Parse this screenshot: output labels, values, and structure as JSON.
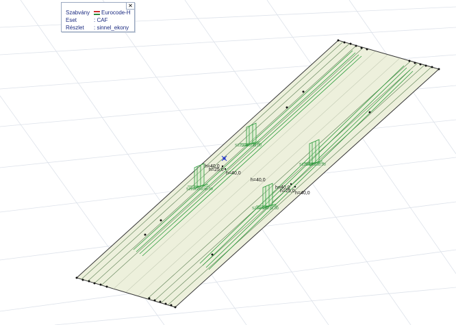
{
  "info_panel": {
    "close_label": "✕",
    "flag_colors": [
      "#cc2a2a",
      "#ffffff",
      "#2a8a3a"
    ],
    "rows": [
      {
        "label": "Szabvány",
        "value": "Eurocode-H"
      },
      {
        "label": "Eset",
        "value": ": CAF"
      },
      {
        "label": "Részlet",
        "value": ": sinnel_ekony"
      }
    ]
  },
  "viewport": {
    "dimension_labels": [
      "h=40,0",
      "h=25,0",
      "h=40,0",
      "h=40,0",
      "h=40,0",
      "h=25,0",
      "h=40,0"
    ],
    "node_labels": [
      "S220/150/38.00",
      "S220/150/38.00",
      "S220/150/38.00",
      "S220/150/38.00"
    ],
    "colors": {
      "deck_fill": "#edf0dc",
      "grid": "#dde2ea",
      "beam": "#2a9a3a",
      "edge": "#222222",
      "marker": "#2233cc"
    }
  }
}
